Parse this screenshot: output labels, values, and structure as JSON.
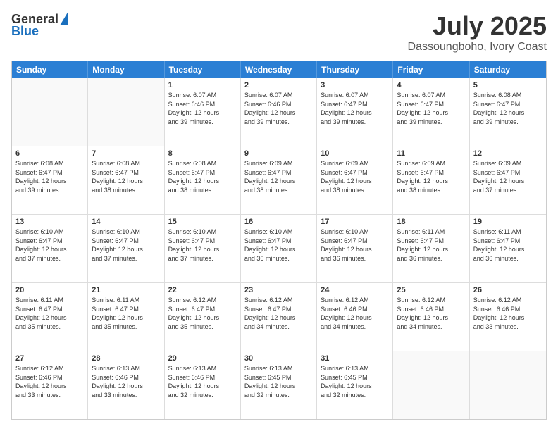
{
  "logo": {
    "line1": "General",
    "line2": "Blue"
  },
  "title": "July 2025",
  "subtitle": "Dassoungboho, Ivory Coast",
  "days_of_week": [
    "Sunday",
    "Monday",
    "Tuesday",
    "Wednesday",
    "Thursday",
    "Friday",
    "Saturday"
  ],
  "weeks": [
    [
      {
        "day": "",
        "info": ""
      },
      {
        "day": "",
        "info": ""
      },
      {
        "day": "1",
        "info": "Sunrise: 6:07 AM\nSunset: 6:46 PM\nDaylight: 12 hours\nand 39 minutes."
      },
      {
        "day": "2",
        "info": "Sunrise: 6:07 AM\nSunset: 6:46 PM\nDaylight: 12 hours\nand 39 minutes."
      },
      {
        "day": "3",
        "info": "Sunrise: 6:07 AM\nSunset: 6:47 PM\nDaylight: 12 hours\nand 39 minutes."
      },
      {
        "day": "4",
        "info": "Sunrise: 6:07 AM\nSunset: 6:47 PM\nDaylight: 12 hours\nand 39 minutes."
      },
      {
        "day": "5",
        "info": "Sunrise: 6:08 AM\nSunset: 6:47 PM\nDaylight: 12 hours\nand 39 minutes."
      }
    ],
    [
      {
        "day": "6",
        "info": "Sunrise: 6:08 AM\nSunset: 6:47 PM\nDaylight: 12 hours\nand 39 minutes."
      },
      {
        "day": "7",
        "info": "Sunrise: 6:08 AM\nSunset: 6:47 PM\nDaylight: 12 hours\nand 38 minutes."
      },
      {
        "day": "8",
        "info": "Sunrise: 6:08 AM\nSunset: 6:47 PM\nDaylight: 12 hours\nand 38 minutes."
      },
      {
        "day": "9",
        "info": "Sunrise: 6:09 AM\nSunset: 6:47 PM\nDaylight: 12 hours\nand 38 minutes."
      },
      {
        "day": "10",
        "info": "Sunrise: 6:09 AM\nSunset: 6:47 PM\nDaylight: 12 hours\nand 38 minutes."
      },
      {
        "day": "11",
        "info": "Sunrise: 6:09 AM\nSunset: 6:47 PM\nDaylight: 12 hours\nand 38 minutes."
      },
      {
        "day": "12",
        "info": "Sunrise: 6:09 AM\nSunset: 6:47 PM\nDaylight: 12 hours\nand 37 minutes."
      }
    ],
    [
      {
        "day": "13",
        "info": "Sunrise: 6:10 AM\nSunset: 6:47 PM\nDaylight: 12 hours\nand 37 minutes."
      },
      {
        "day": "14",
        "info": "Sunrise: 6:10 AM\nSunset: 6:47 PM\nDaylight: 12 hours\nand 37 minutes."
      },
      {
        "day": "15",
        "info": "Sunrise: 6:10 AM\nSunset: 6:47 PM\nDaylight: 12 hours\nand 37 minutes."
      },
      {
        "day": "16",
        "info": "Sunrise: 6:10 AM\nSunset: 6:47 PM\nDaylight: 12 hours\nand 36 minutes."
      },
      {
        "day": "17",
        "info": "Sunrise: 6:10 AM\nSunset: 6:47 PM\nDaylight: 12 hours\nand 36 minutes."
      },
      {
        "day": "18",
        "info": "Sunrise: 6:11 AM\nSunset: 6:47 PM\nDaylight: 12 hours\nand 36 minutes."
      },
      {
        "day": "19",
        "info": "Sunrise: 6:11 AM\nSunset: 6:47 PM\nDaylight: 12 hours\nand 36 minutes."
      }
    ],
    [
      {
        "day": "20",
        "info": "Sunrise: 6:11 AM\nSunset: 6:47 PM\nDaylight: 12 hours\nand 35 minutes."
      },
      {
        "day": "21",
        "info": "Sunrise: 6:11 AM\nSunset: 6:47 PM\nDaylight: 12 hours\nand 35 minutes."
      },
      {
        "day": "22",
        "info": "Sunrise: 6:12 AM\nSunset: 6:47 PM\nDaylight: 12 hours\nand 35 minutes."
      },
      {
        "day": "23",
        "info": "Sunrise: 6:12 AM\nSunset: 6:47 PM\nDaylight: 12 hours\nand 34 minutes."
      },
      {
        "day": "24",
        "info": "Sunrise: 6:12 AM\nSunset: 6:46 PM\nDaylight: 12 hours\nand 34 minutes."
      },
      {
        "day": "25",
        "info": "Sunrise: 6:12 AM\nSunset: 6:46 PM\nDaylight: 12 hours\nand 34 minutes."
      },
      {
        "day": "26",
        "info": "Sunrise: 6:12 AM\nSunset: 6:46 PM\nDaylight: 12 hours\nand 33 minutes."
      }
    ],
    [
      {
        "day": "27",
        "info": "Sunrise: 6:12 AM\nSunset: 6:46 PM\nDaylight: 12 hours\nand 33 minutes."
      },
      {
        "day": "28",
        "info": "Sunrise: 6:13 AM\nSunset: 6:46 PM\nDaylight: 12 hours\nand 33 minutes."
      },
      {
        "day": "29",
        "info": "Sunrise: 6:13 AM\nSunset: 6:46 PM\nDaylight: 12 hours\nand 32 minutes."
      },
      {
        "day": "30",
        "info": "Sunrise: 6:13 AM\nSunset: 6:45 PM\nDaylight: 12 hours\nand 32 minutes."
      },
      {
        "day": "31",
        "info": "Sunrise: 6:13 AM\nSunset: 6:45 PM\nDaylight: 12 hours\nand 32 minutes."
      },
      {
        "day": "",
        "info": ""
      },
      {
        "day": "",
        "info": ""
      }
    ]
  ]
}
